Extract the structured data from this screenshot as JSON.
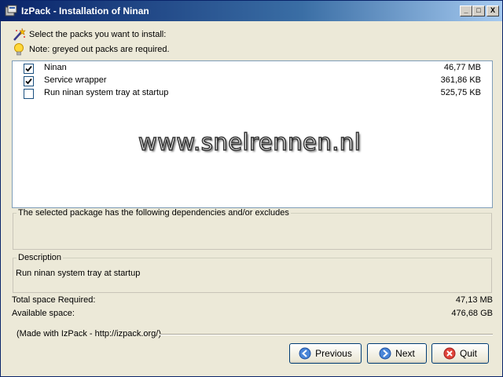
{
  "window": {
    "title": "IzPack - Installation of Ninan",
    "min_label": "_",
    "max_label": "□",
    "close_label": "X"
  },
  "hints": {
    "select": "Select the packs you want to install:",
    "note": "Note: greyed out packs are required."
  },
  "packs": [
    {
      "name": "Ninan",
      "size": "46,77 MB",
      "checked": true
    },
    {
      "name": "Service wrapper",
      "size": "361,86 KB",
      "checked": true
    },
    {
      "name": "Run ninan system tray at startup",
      "size": "525,75 KB",
      "checked": false
    }
  ],
  "watermark": "www.snelrennen.nl",
  "dependencies": {
    "legend": "The selected package has the following dependencies and/or excludes"
  },
  "description": {
    "legend": "Description",
    "text": "Run ninan system tray at startup"
  },
  "space": {
    "required_label": "Total space Required:",
    "required_value": "47,13 MB",
    "available_label": "Available space:",
    "available_value": "476,68 GB"
  },
  "footer": {
    "made_with": "(Made with IzPack - http://izpack.org/)"
  },
  "buttons": {
    "previous": "Previous",
    "next": "Next",
    "quit": "Quit"
  },
  "colors": {
    "title_bar": "#0a246a",
    "window_bg": "#ece9d8",
    "list_border": "#7f9db9",
    "button_border": "#003c74"
  },
  "icons": {
    "title": "izpack-app-icon",
    "select": "magic-wand-icon",
    "note": "lightbulb-icon",
    "previous": "arrow-left-icon",
    "next": "arrow-right-icon",
    "quit": "cancel-icon"
  }
}
